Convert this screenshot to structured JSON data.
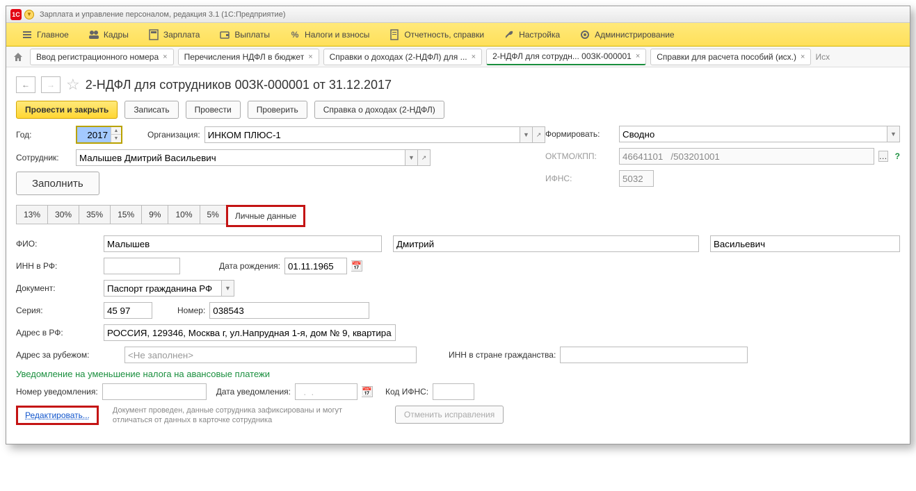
{
  "titlebar": {
    "title": "Зарплата и управление персоналом, редакция 3.1  (1С:Предприятие)"
  },
  "mainmenu": {
    "home": "Главное",
    "staff": "Кадры",
    "salary": "Зарплата",
    "payments": "Выплаты",
    "taxes": "Налоги и взносы",
    "reports": "Отчетность, справки",
    "settings": "Настройка",
    "admin": "Администрирование"
  },
  "tabs": {
    "t1": "Ввод регистрационного номера",
    "t2": "Перечисления НДФЛ в бюджет",
    "t3": "Справки о доходах (2-НДФЛ) для ...",
    "t4": "2-НДФЛ для сотрудн... 00ЗК-000001",
    "t5": "Справки для расчета пособий (исх.)",
    "t6": "Исх"
  },
  "header": {
    "title": "2-НДФЛ для сотрудников 00ЗК-000001 от 31.12.2017"
  },
  "cmd": {
    "post_close": "Провести и закрыть",
    "save": "Записать",
    "post": "Провести",
    "check": "Проверить",
    "cert": "Справка о доходах (2-НДФЛ)"
  },
  "form": {
    "year_label": "Год:",
    "year_value": "2017",
    "org_label": "Организация:",
    "org_value": "ИНКОМ ПЛЮС-1",
    "emp_label": "Сотрудник:",
    "emp_value": "Малышев Дмитрий Васильевич",
    "fill": "Заполнить",
    "form_label": "Формировать:",
    "form_value": "Сводно",
    "oktmo_label": "ОКТМО/КПП:",
    "oktmo_value": "46641101   /503201001",
    "ifns_label": "ИФНС:",
    "ifns_value": "5032"
  },
  "rates": {
    "r1": "13%",
    "r2": "30%",
    "r3": "35%",
    "r4": "15%",
    "r5": "9%",
    "r6": "10%",
    "r7": "5%",
    "r8": "Личные данные"
  },
  "personal": {
    "fio_label": "ФИО:",
    "last": "Малышев",
    "first": "Дмитрий",
    "middle": "Васильевич",
    "inn_label": "ИНН в РФ:",
    "dob_label": "Дата рождения:",
    "dob_value": "01.11.1965",
    "doc_label": "Документ:",
    "doc_value": "Паспорт гражданина РФ",
    "series_label": "Серия:",
    "series_value": "45 97",
    "number_label": "Номер:",
    "number_value": "038543",
    "addr_rf_label": "Адрес в РФ:",
    "addr_rf_value": "РОССИЯ, 129346, Москва г, ул.Напрудная 1-я, дом № 9, квартира",
    "addr_abroad_label": "Адрес за рубежом:",
    "addr_abroad_value": "<Не заполнен>",
    "inn_abroad_label": "ИНН в стране гражданства:"
  },
  "notice": {
    "section_title": "Уведомление на уменьшение налога на авансовые платежи",
    "num_label": "Номер уведомления:",
    "date_label": "Дата уведомления:",
    "date_value": "  .  .",
    "ifns_label": "Код ИФНС:"
  },
  "footer": {
    "edit": "Редактировать...",
    "hint": "Документ проведен, данные сотрудника зафиксированы и могут отличаться от данных в карточке сотрудника",
    "cancel": "Отменить исправления"
  }
}
